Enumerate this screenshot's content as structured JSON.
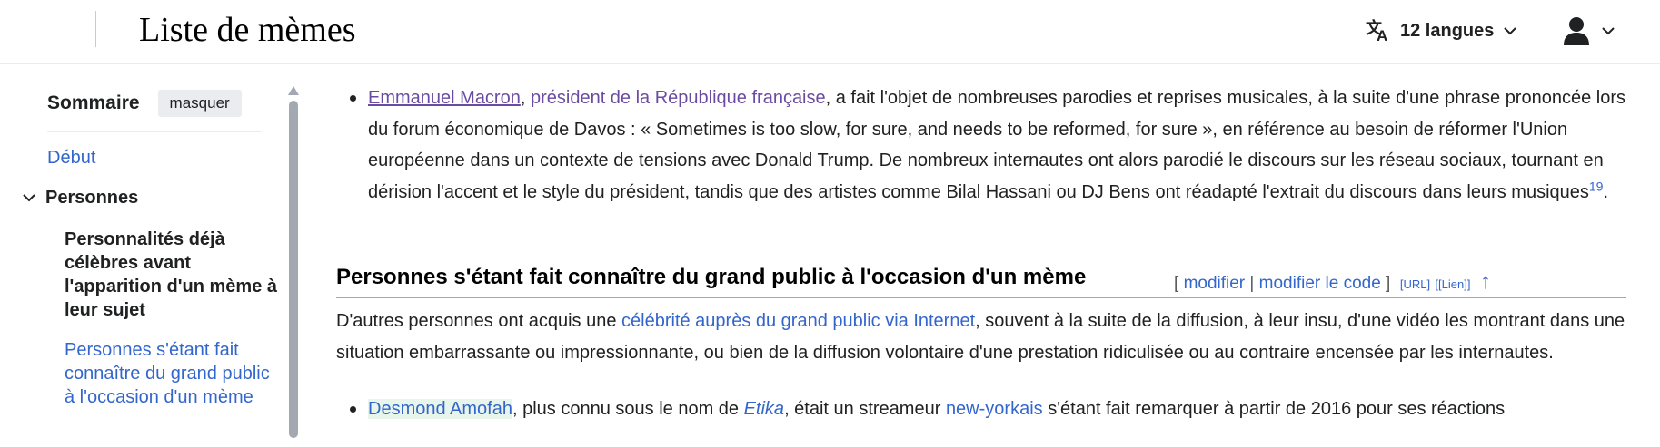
{
  "header": {
    "page_title": "Liste de mèmes",
    "languages_label": "12 langues",
    "icons": [
      "translate-icon",
      "chevron-down-icon",
      "user-icon"
    ]
  },
  "toc": {
    "title": "Sommaire",
    "hide_label": "masquer",
    "top_label": "Début",
    "section_label": "Personnes",
    "sub_items": [
      "Personnalités déjà célèbres avant l'apparition d'un mème à leur sujet",
      "Personnes s'étant fait connaître du grand public à l'occasion d'un mème"
    ]
  },
  "content": {
    "item1": {
      "link1": "Emmanuel Macron",
      "sep": ", ",
      "link2": "président de la République française",
      "text": ", a fait l'objet de nombreuses parodies et reprises musicales, à la suite d'une phrase prononcée lors du forum économique de Davos : « Sometimes is too slow, for sure, and needs to be reformed, for sure », en référence au besoin de réformer l'Union européenne dans un contexte de tensions avec Donald Trump. De nombreux internautes ont alors parodié le discours sur les réseau sociaux, tournant en dérision l'accent et le style du président, tandis que des artistes comme Bilal Hassani ou DJ Bens ont réadapté l'extrait du discours dans leurs musiques",
      "ref": "19",
      "end": "."
    },
    "section_heading": {
      "title": "Personnes s'étant fait connaître du grand public à l'occasion d'un mème",
      "bracket_open": "[",
      "edit_label": "modifier",
      "pipe": "|",
      "edit_code_label": "modifier le code",
      "bracket_close": "]",
      "url_label": "[URL]",
      "lien_label": "[[Lien]]",
      "arrow": "↑"
    },
    "paragraph": {
      "text1": "D'autres personnes ont acquis une ",
      "link": "célébrité auprès du grand public via Internet",
      "text2": ", souvent à la suite de la diffusion, à leur insu, d'une vidéo les montrant dans une situation embarrassante ou impressionnante, ou bien de la diffusion volontaire d'une prestation ridiculisée ou au contraire encensée par les internautes."
    },
    "item2": {
      "link1": "Desmond Amofah",
      "text1": ", plus connu sous le nom de ",
      "italic": "Etika",
      "text2": ", était un streameur ",
      "link2": "new-yorkais",
      "text3": " s'étant fait remarquer à partir de 2016 pour ses réactions"
    }
  },
  "colors": {
    "link": "#3366cc",
    "visited_link": "#6b4ba1",
    "text": "#202122",
    "highlight": "#e8f5ea"
  }
}
